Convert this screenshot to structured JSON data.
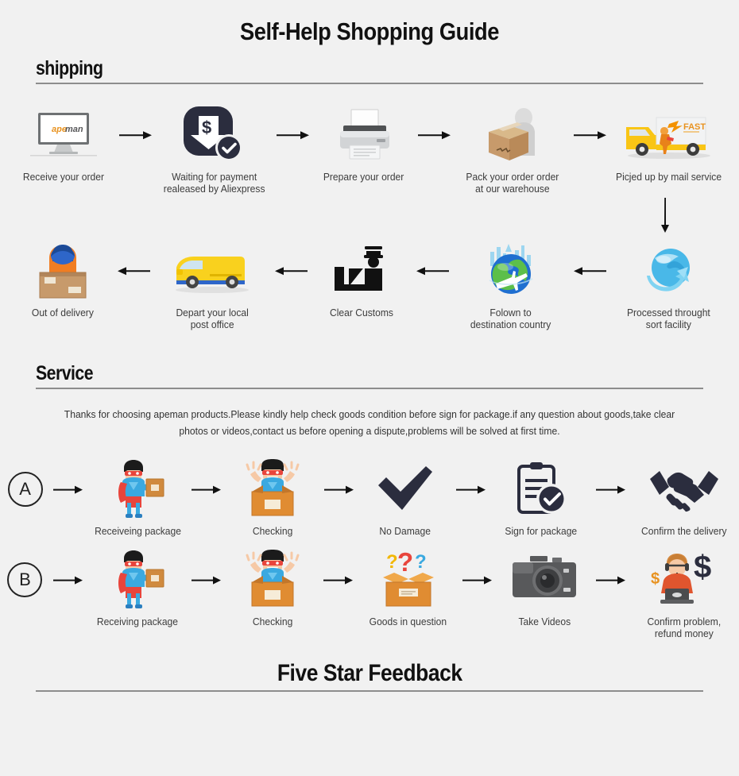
{
  "title": "Self-Help Shopping Guide",
  "sections": {
    "shipping": {
      "heading": "shipping"
    },
    "service": {
      "heading": "Service",
      "paragraph": "Thanks for choosing apeman products.Please kindly help check goods condition before sign for package.if any question about goods,take clear photos or videos,contact us before opening a dispute,problems will be solved at first time."
    },
    "footer": {
      "heading": "Five Star Feedback"
    }
  },
  "shipping_row1": [
    {
      "icon": "monitor-apeman-icon",
      "caption": "Receive your order",
      "brand_a": "ape",
      "brand_b": "man"
    },
    {
      "icon": "payment-dollar-check-icon",
      "caption": "Waiting for payment\nrealeased by Aliexpress"
    },
    {
      "icon": "printer-icon",
      "caption": "Prepare your order"
    },
    {
      "icon": "packing-box-worker-icon",
      "caption": "Pack your order order\nat our warehouse"
    },
    {
      "icon": "fast-delivery-truck-icon",
      "caption": "Picjed up by mail service",
      "truck_label": "FAST"
    }
  ],
  "shipping_row2": [
    {
      "icon": "delivery-person-box-icon",
      "caption": "Out of delivery"
    },
    {
      "icon": "yellow-van-icon",
      "caption": "Depart your local\npost office"
    },
    {
      "icon": "customs-officer-icon",
      "caption": "Clear Customs"
    },
    {
      "icon": "globe-airplane-icon",
      "caption": "Folown to\ndestination country"
    },
    {
      "icon": "globe-sort-facility-icon",
      "caption": "Processed throught\nsort facility"
    }
  ],
  "service_row_a": {
    "badge": "A",
    "steps": [
      {
        "icon": "superhero-package-icon",
        "caption": "Receiveing package"
      },
      {
        "icon": "superhero-open-box-icon",
        "caption": "Checking"
      },
      {
        "icon": "checkmark-icon",
        "caption": "No Damage"
      },
      {
        "icon": "clipboard-check-icon",
        "caption": "Sign for package"
      },
      {
        "icon": "handshake-icon",
        "caption": "Confirm the delivery"
      }
    ]
  },
  "service_row_b": {
    "badge": "B",
    "steps": [
      {
        "icon": "superhero-package-icon",
        "caption": "Receiving package"
      },
      {
        "icon": "superhero-open-box-icon",
        "caption": "Checking"
      },
      {
        "icon": "question-box-icon",
        "caption": "Goods in question"
      },
      {
        "icon": "camera-icon",
        "caption": "Take Videos"
      },
      {
        "icon": "support-agent-dollar-icon",
        "caption": "Confirm problem,\nrefund money"
      }
    ]
  },
  "colors": {
    "background": "#f1f1f1",
    "rule": "#8d8d8d",
    "dark_navy": "#2b2d3e",
    "brand_orange": "#e8921f",
    "brand_gray": "#58585a",
    "truck_yellow": "#f9c515",
    "box_brown": "#c79a6b",
    "hero_red": "#e8453c",
    "hero_blue": "#3aa9e0"
  }
}
